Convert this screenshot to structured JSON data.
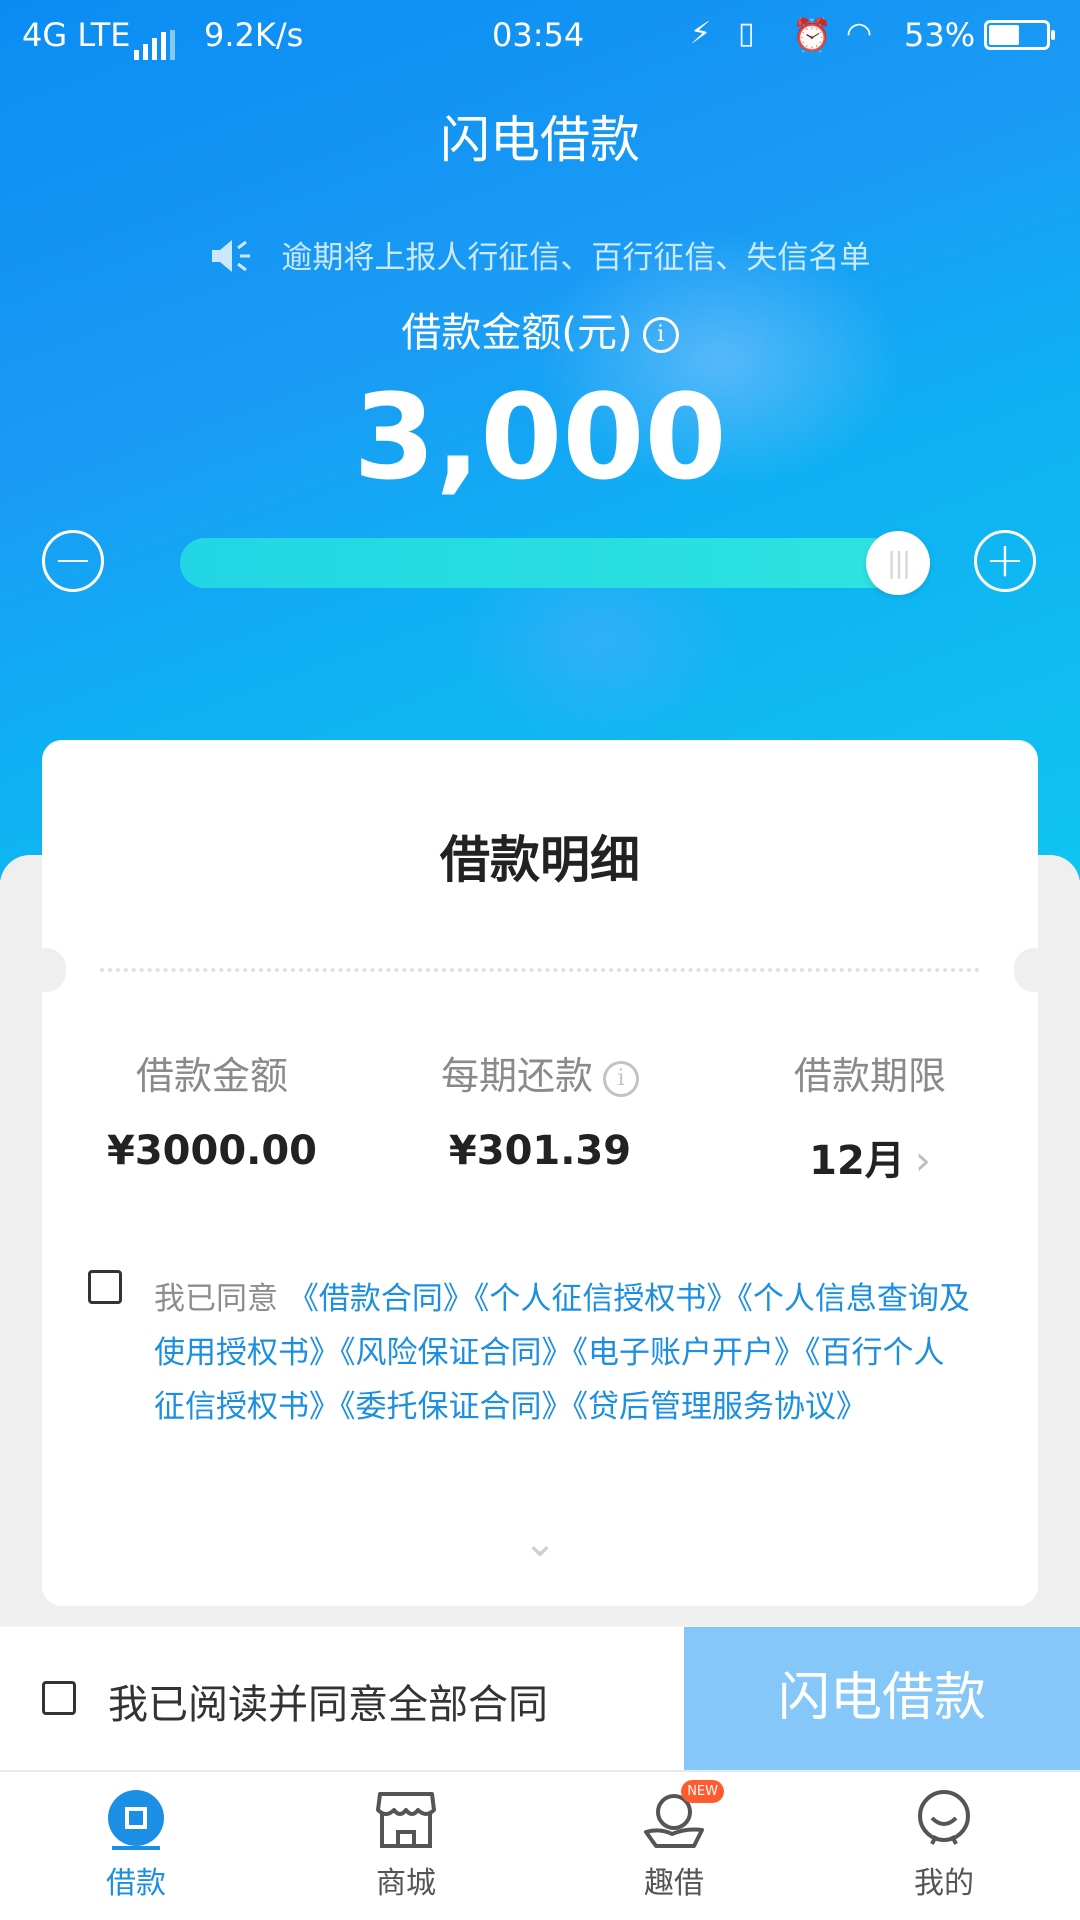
{
  "status_bar": {
    "network": "4G LTE",
    "speed": "9.2K/s",
    "time": "03:54",
    "battery": "53%",
    "battery_level": 0.53
  },
  "header": {
    "title": "闪电借款"
  },
  "notice": {
    "text": "逾期将上报人行征信、百行征信、失信名单",
    "icon": "speaker-icon"
  },
  "loan": {
    "amount_label": "借款金额(元)",
    "amount": "3,000",
    "slider_fraction": 1.0,
    "minus_icon": "minus-circle-icon",
    "plus_icon": "plus-circle-icon"
  },
  "details": {
    "title": "借款明细",
    "columns": [
      {
        "label": "借款金额",
        "value": "¥3000.00"
      },
      {
        "label": "每期还款",
        "value": "¥301.39"
      },
      {
        "label": "借款期限",
        "value": "12月"
      }
    ]
  },
  "agreements": {
    "prefix": "我已同意",
    "items": [
      "《借款合同》",
      "《个人征信授权书》",
      "《个人信息查询及使用授权书》",
      "《风险保证合同》",
      "《电子账户开户》",
      "《百行个人征信授权书》",
      "《委托保证合同》",
      "《贷后管理服务协议》"
    ]
  },
  "footer": {
    "agree_all": "我已阅读并同意全部合同",
    "submit": "闪电借款"
  },
  "tabs": [
    {
      "label": "借款",
      "icon": "loan-icon",
      "active": true
    },
    {
      "label": "商城",
      "icon": "shop-icon",
      "active": false
    },
    {
      "label": "趣借",
      "icon": "fun-loan-icon",
      "active": false,
      "badge": "NEW"
    },
    {
      "label": "我的",
      "icon": "profile-icon",
      "active": false
    }
  ],
  "colors": {
    "primary": "#1a8fe3",
    "hero_top": "#0a8cf3",
    "hero_bottom": "#10c4f0",
    "button_disabled": "#85c7f8",
    "badge": "#ff5b2e"
  }
}
